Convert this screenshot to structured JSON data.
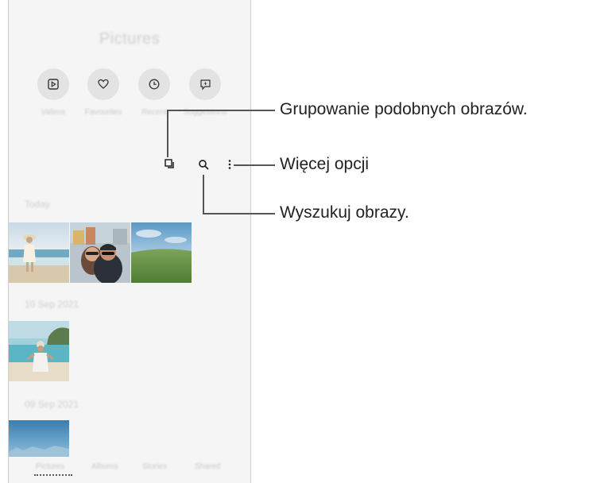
{
  "app": {
    "title": "Pictures"
  },
  "quick_actions": [
    {
      "label": "Videos",
      "icon": "play-icon"
    },
    {
      "label": "Favourites",
      "icon": "heart-icon"
    },
    {
      "label": "Recent",
      "icon": "clock-icon"
    },
    {
      "label": "Suggestions",
      "icon": "sparkle-chat-icon"
    }
  ],
  "toolbar": {
    "group_icon": "group-similar-icon",
    "search_icon": "search-icon",
    "more_icon": "more-options-icon"
  },
  "sections": [
    {
      "heading": "Today"
    },
    {
      "heading": "10 Sep 2021"
    },
    {
      "heading": "09 Sep 2021"
    }
  ],
  "bottom_tabs": [
    {
      "label": "Pictures"
    },
    {
      "label": "Albums"
    },
    {
      "label": "Stories"
    },
    {
      "label": "Shared"
    }
  ],
  "callouts": {
    "group": "Grupowanie podobnych obrazów.",
    "more": "Więcej opcji",
    "search": "Wyszukuj obrazy."
  }
}
